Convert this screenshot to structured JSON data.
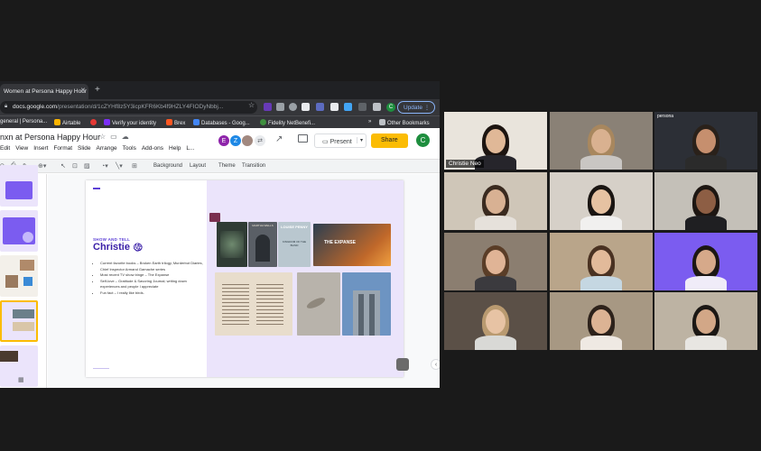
{
  "browser": {
    "tab_title": "Women at Persona Happy Hour",
    "url_host": "docs.google.com",
    "url_path": "/presentation/d/1cZYHf8z5Y3icpKFR6Kb4f9HZLY4FIODyNbbj...",
    "update_label": "Update",
    "bookmarks": [
      {
        "label": "general | Persona...",
        "color": "#9aa0a6"
      },
      {
        "label": "Airtable",
        "color": "#fcb400"
      },
      {
        "label": "",
        "color": "#e53935"
      },
      {
        "label": "Verify your identity",
        "color": "#7b2ff7"
      },
      {
        "label": "Brex",
        "color": "#ff5722"
      },
      {
        "label": "Databases - Goog...",
        "color": "#4285f4"
      },
      {
        "label": "Fidelity NetBenefi...",
        "color": "#3f8f3f"
      }
    ],
    "other_bookmarks": "Other Bookmarks"
  },
  "slides_app": {
    "doc_title": "nxn at Persona Happy Hour",
    "menus": [
      "Edit",
      "View",
      "Insert",
      "Format",
      "Slide",
      "Arrange",
      "Tools",
      "Add-ons",
      "Help",
      "L..."
    ],
    "collaborators": [
      {
        "initial": "E",
        "color": "#8e24aa"
      },
      {
        "initial": "Z",
        "color": "#1e88e5"
      },
      {
        "initial": "",
        "color": "#a1887f"
      }
    ],
    "present_label": "Present",
    "share_label": "Share",
    "user_initial": "C",
    "toolbar": {
      "background": "Background",
      "layout": "Layout",
      "theme": "Theme",
      "transition": "Transition"
    }
  },
  "slide": {
    "eyebrow": "SHOW AND TELL",
    "name": "Christie",
    "bullets": [
      "Current favorite books – Broken Earth trilogy, Murderbot Diaries, Chief Inspector Armand Gamache series",
      "Most recent TV show binge – The Expanse",
      "Self-love – Gratitude & Savoring Journal; writing down experiences and people I appreciate",
      "Fun fact – I really like birds."
    ],
    "books": [
      {
        "label": "",
        "color": "#2f3b34"
      },
      {
        "label": "MARTHA WELLS",
        "color": "#5a5f66"
      },
      {
        "label": "LOUISE PENNY",
        "color": "#b9c7cf"
      }
    ],
    "kingdom_text": "KINGDOM OF THE BLIND",
    "expanse_text": "THE EXPANSE"
  },
  "zoom": {
    "active_speaker": "Christie Neo",
    "watermark_persona": "persona",
    "tiles": [
      {
        "bg": "#e9e4dc",
        "hair": "#1c1410",
        "skin": "#e0b897",
        "shirt": "#26252b"
      },
      {
        "bg": "#8a8176",
        "hair": "#a8875e",
        "skin": "#d9b190",
        "shirt": "#c9c6c3"
      },
      {
        "bg": "#2c2f36",
        "hair": "#2a211a",
        "skin": "#c68f6e",
        "shirt": "#2b2b2b"
      },
      {
        "bg": "#cfc6b8",
        "hair": "#3a2a1f",
        "skin": "#d8b193",
        "shirt": "#e6e1db"
      },
      {
        "bg": "#d6d0c8",
        "hair": "#1a1512",
        "skin": "#e6c2a2",
        "shirt": "#f1f0ef"
      },
      {
        "bg": "#c4c0b8",
        "hair": "#1d1612",
        "skin": "#8d5e44",
        "shirt": "#1f1f22"
      },
      {
        "bg": "#8b7e70",
        "hair": "#5a3d27",
        "skin": "#e0b496",
        "shirt": "#3b3a3e"
      },
      {
        "bg": "#b9a58a",
        "hair": "#4a3222",
        "skin": "#e2ba9a",
        "shirt": "#c5d7e2"
      },
      {
        "bg": "#7b5cf0",
        "hair": "#1c1714",
        "skin": "#d6a98a",
        "shirt": "#f0ecf8"
      },
      {
        "bg": "#5b5047",
        "hair": "#b99a70",
        "skin": "#e7c3a4",
        "shirt": "#d9d9d6"
      },
      {
        "bg": "#a79883",
        "hair": "#2d221b",
        "skin": "#dcb394",
        "shirt": "#efe9e3"
      },
      {
        "bg": "#bdb3a3",
        "hair": "#1b1714",
        "skin": "#d2a787",
        "shirt": "#e8e6e2"
      }
    ]
  }
}
